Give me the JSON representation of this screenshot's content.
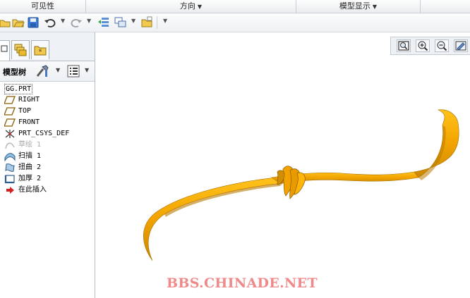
{
  "ribbon": {
    "groups": [
      {
        "label": "可见性",
        "has_dropdown": false
      },
      {
        "label": "方向",
        "has_dropdown": true
      },
      {
        "label": "模型显示",
        "has_dropdown": true
      },
      {
        "label": "",
        "has_dropdown": false
      }
    ]
  },
  "quick_access": {
    "icons": [
      "open-icon",
      "save-icon",
      "undo-icon",
      "redo-icon",
      "regenerate-icon",
      "windows-icon",
      "folder-icon",
      "customize-icon"
    ]
  },
  "left_panel": {
    "tabs": [
      "model-tree-tab",
      "folder-browser-tab",
      "favorites-tab"
    ],
    "tree_header": {
      "title": "模型树"
    },
    "tree_items": [
      {
        "label": "GG.PRT",
        "icon": "part-icon",
        "state": "root"
      },
      {
        "label": "RIGHT",
        "icon": "datum-plane-icon",
        "state": "normal"
      },
      {
        "label": "TOP",
        "icon": "datum-plane-icon",
        "state": "normal"
      },
      {
        "label": "FRONT",
        "icon": "datum-plane-icon",
        "state": "normal"
      },
      {
        "label": "PRT_CSYS_DEF",
        "icon": "csys-icon",
        "state": "normal"
      },
      {
        "label": "草绘 1",
        "icon": "sketch-icon",
        "state": "suppressed"
      },
      {
        "label": "扫描 1",
        "icon": "sweep-icon",
        "state": "normal"
      },
      {
        "label": "扭曲 2",
        "icon": "warp-icon",
        "state": "normal"
      },
      {
        "label": "加厚 2",
        "icon": "thicken-icon",
        "state": "normal"
      },
      {
        "label": "在此插入",
        "icon": "insert-here-arrow-icon",
        "state": "insert"
      }
    ]
  },
  "graphics": {
    "view_toolbar": [
      "refit-icon",
      "zoom-in-icon",
      "zoom-out-icon",
      "repaint-icon"
    ],
    "model_color": "#f2a300",
    "model_shadow_color": "#b97a00",
    "watermark": "BBS.CHINADE.NET"
  }
}
